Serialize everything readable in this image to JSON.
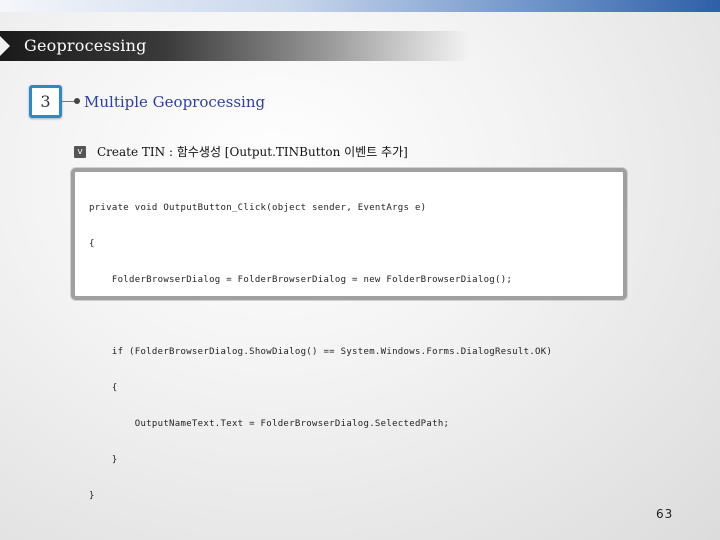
{
  "header": {
    "title": "Geoprocessing"
  },
  "section": {
    "number": "3",
    "title": "Multiple Geoprocessing"
  },
  "bullet": {
    "check": "v",
    "text": "Create TIN : 함수생성 [Output.TINButton 이벤트 추가]"
  },
  "code_lines": [
    "private void OutputButton_Click(object sender, EventArgs e)",
    "{",
    "    FolderBrowserDialog = FolderBrowserDialog = new FolderBrowserDialog();",
    "",
    "    if (FolderBrowserDialog.ShowDialog() == System.Windows.Forms.DialogResult.OK)",
    "    {",
    "        OutputNameText.Text = FolderBrowserDialog.SelectedPath;",
    "    }",
    "}"
  ],
  "page": {
    "number": "63"
  },
  "colors": {
    "section_box_border": "#2a8ac8",
    "section_title": "#2e3fa0"
  }
}
